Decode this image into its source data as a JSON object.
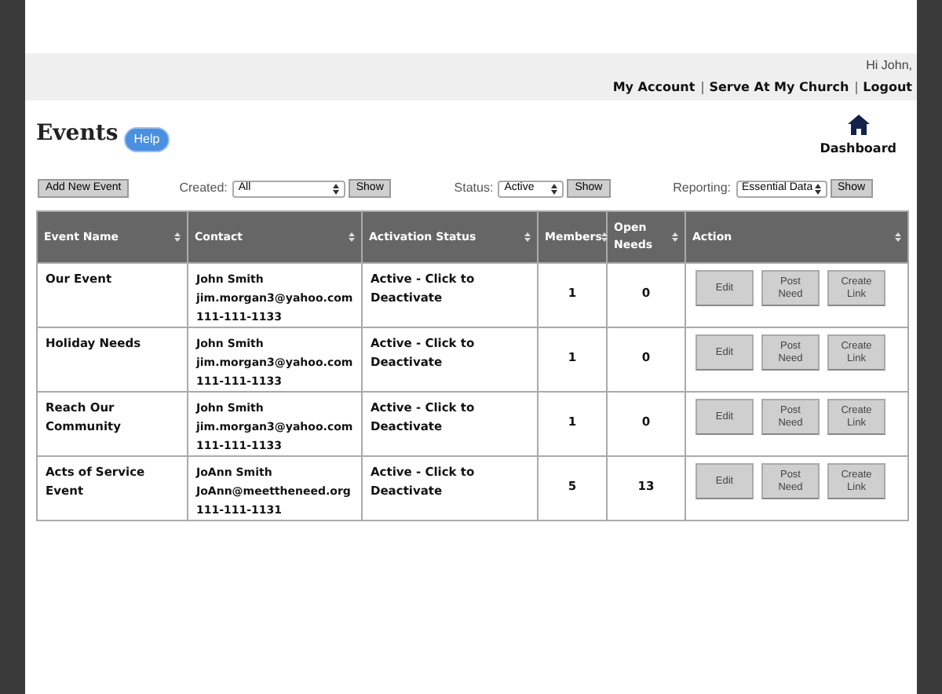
{
  "header": {
    "greeting": "Hi John,",
    "links": [
      "My Account",
      "Serve At My Church",
      "Logout"
    ]
  },
  "page": {
    "title": "Events",
    "help_button": "Help",
    "dashboard_link": "Dashboard"
  },
  "toolbar": {
    "add_button": "Add New Event",
    "filters": [
      {
        "label": "Created:",
        "value": "All",
        "button": "Show"
      },
      {
        "label": "Status:",
        "value": "Active",
        "button": "Show"
      },
      {
        "label": "Reporting:",
        "value": "Essential Data",
        "button": "Show"
      }
    ]
  },
  "table": {
    "columns": [
      "Event Name",
      "Contact",
      "Activation Status",
      "Members",
      "Open Needs",
      "Action"
    ],
    "rows": [
      {
        "event_name": "Our Event",
        "contact": [
          "John Smith",
          "jim.morgan3@yahoo.com",
          "111-111-1133"
        ],
        "activation_status": "Active - Click to Deactivate",
        "members": "1",
        "open_needs": "0",
        "actions": [
          "Edit",
          "Post Need",
          "Create Link"
        ]
      },
      {
        "event_name": "Holiday Needs",
        "contact": [
          "John Smith",
          "jim.morgan3@yahoo.com",
          "111-111-1133"
        ],
        "activation_status": "Active - Click to Deactivate",
        "members": "1",
        "open_needs": "0",
        "actions": [
          "Edit",
          "Post Need",
          "Create Link"
        ]
      },
      {
        "event_name": "Reach Our Community",
        "contact": [
          "John Smith",
          "jim.morgan3@yahoo.com",
          "111-111-1133"
        ],
        "activation_status": "Active - Click to Deactivate",
        "members": "1",
        "open_needs": "0",
        "actions": [
          "Edit",
          "Post Need",
          "Create Link"
        ]
      },
      {
        "event_name": "Acts of Service Event",
        "contact": [
          "JoAnn Smith",
          "JoAnn@meettheneed.org",
          "111-111-1131"
        ],
        "activation_status": "Active - Click to Deactivate",
        "members": "5",
        "open_needs": "13",
        "actions": [
          "Edit",
          "Post Need",
          "Create Link"
        ]
      }
    ]
  }
}
